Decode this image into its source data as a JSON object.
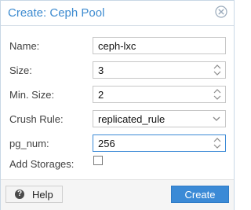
{
  "dialog": {
    "title": "Create: Ceph Pool",
    "title_color": "#3d8bd0",
    "close_icon": "close-circle-icon"
  },
  "form": {
    "name": {
      "label": "Name:",
      "value": "ceph-lxc"
    },
    "size": {
      "label": "Size:",
      "value": "3"
    },
    "min_size": {
      "label": "Min. Size:",
      "value": "2"
    },
    "crush_rule": {
      "label": "Crush Rule:",
      "value": "replicated_rule"
    },
    "pg_num": {
      "label": "pg_num:",
      "value": "256"
    },
    "add_storages": {
      "label": "Add Storages:",
      "checked": false
    }
  },
  "footer": {
    "help_label": "Help",
    "help_icon": "question-circle-icon",
    "create_label": "Create",
    "accent": "#3b8ad6"
  }
}
